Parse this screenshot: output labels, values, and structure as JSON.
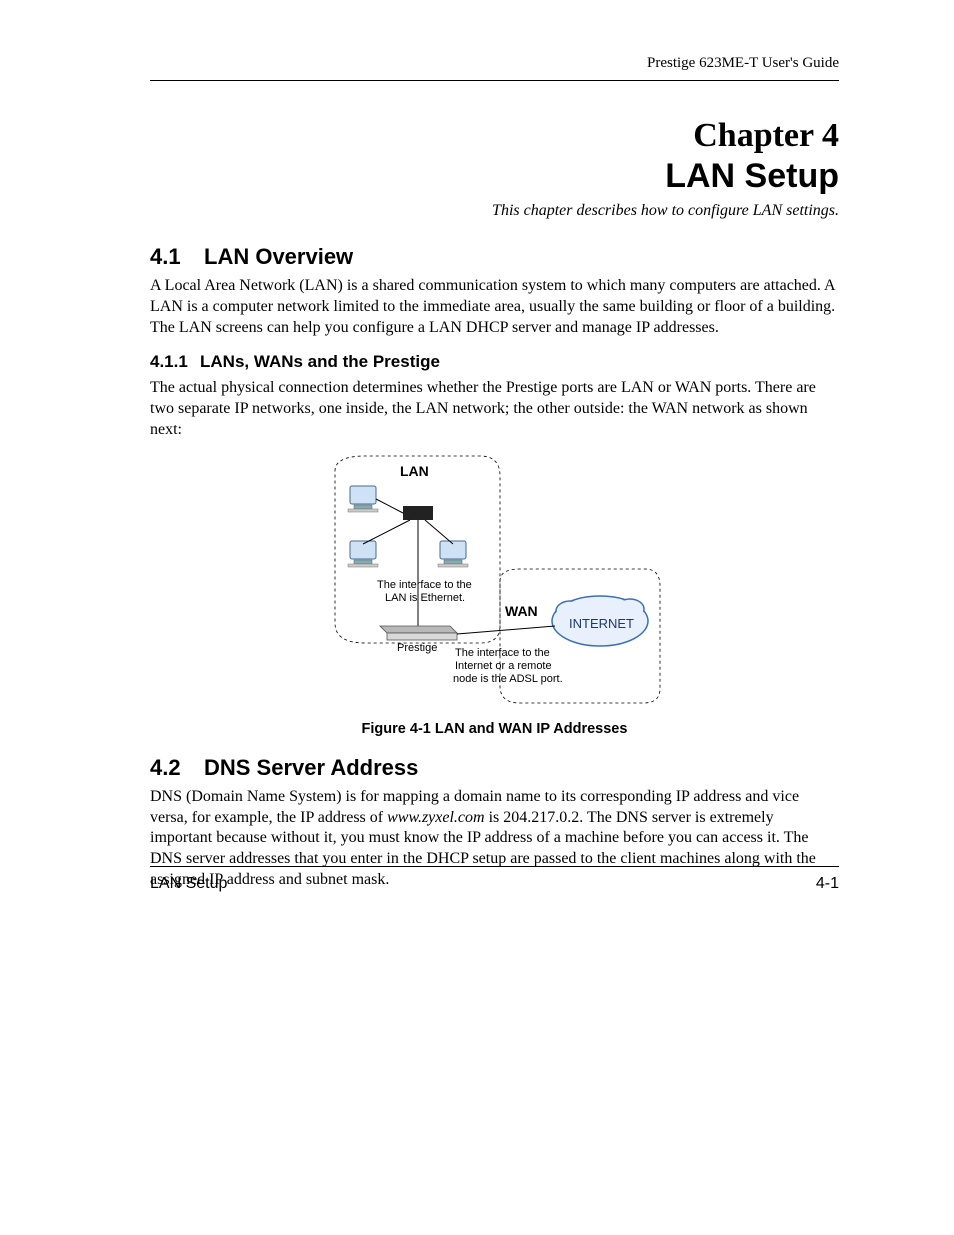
{
  "header": {
    "right_text": "Prestige 623ME-T User's Guide"
  },
  "chapter": {
    "number": "Chapter 4",
    "title": "LAN Setup",
    "description": "This chapter describes how to configure LAN settings."
  },
  "section_4_1": {
    "num": "4.1",
    "title": "LAN Overview",
    "para": "A Local Area Network (LAN) is a shared communication system to which many computers are attached. A LAN is a computer network limited to the immediate area, usually the same building or floor of a building. The LAN screens can help you configure a LAN DHCP server and manage IP addresses."
  },
  "section_4_1_1": {
    "num": "4.1.1",
    "title": "LANs, WANs and the Prestige",
    "para": "The actual physical connection determines whether the Prestige ports are LAN or WAN ports. There are two separate IP networks, one inside, the LAN network; the other outside: the WAN network as shown next:"
  },
  "figure": {
    "caption": "Figure 4-1 LAN and WAN IP Addresses",
    "labels": {
      "lan": "LAN",
      "wan": "WAN",
      "internet": "INTERNET",
      "prestige": "Prestige",
      "lan_note": "The interface to the\nLAN is Ethernet.",
      "wan_note": "The interface to the\nInternet or a remote\nnode is the ADSL port."
    }
  },
  "section_4_2": {
    "num": "4.2",
    "title": "DNS Server Address",
    "para_pre": "DNS (Domain Name System) is for mapping a domain name to its corresponding IP address and vice versa, for example, the IP address of ",
    "para_domain": "www.zyxel.com",
    "para_post": " is 204.217.0.2.  The DNS server is extremely important because without it, you must know the IP address of a machine before you can access it.  The DNS server addresses that you enter in the DHCP setup are passed to the client machines along with the assigned IP address and subnet mask."
  },
  "footer": {
    "left": "LAN Setup",
    "right": "4-1"
  }
}
